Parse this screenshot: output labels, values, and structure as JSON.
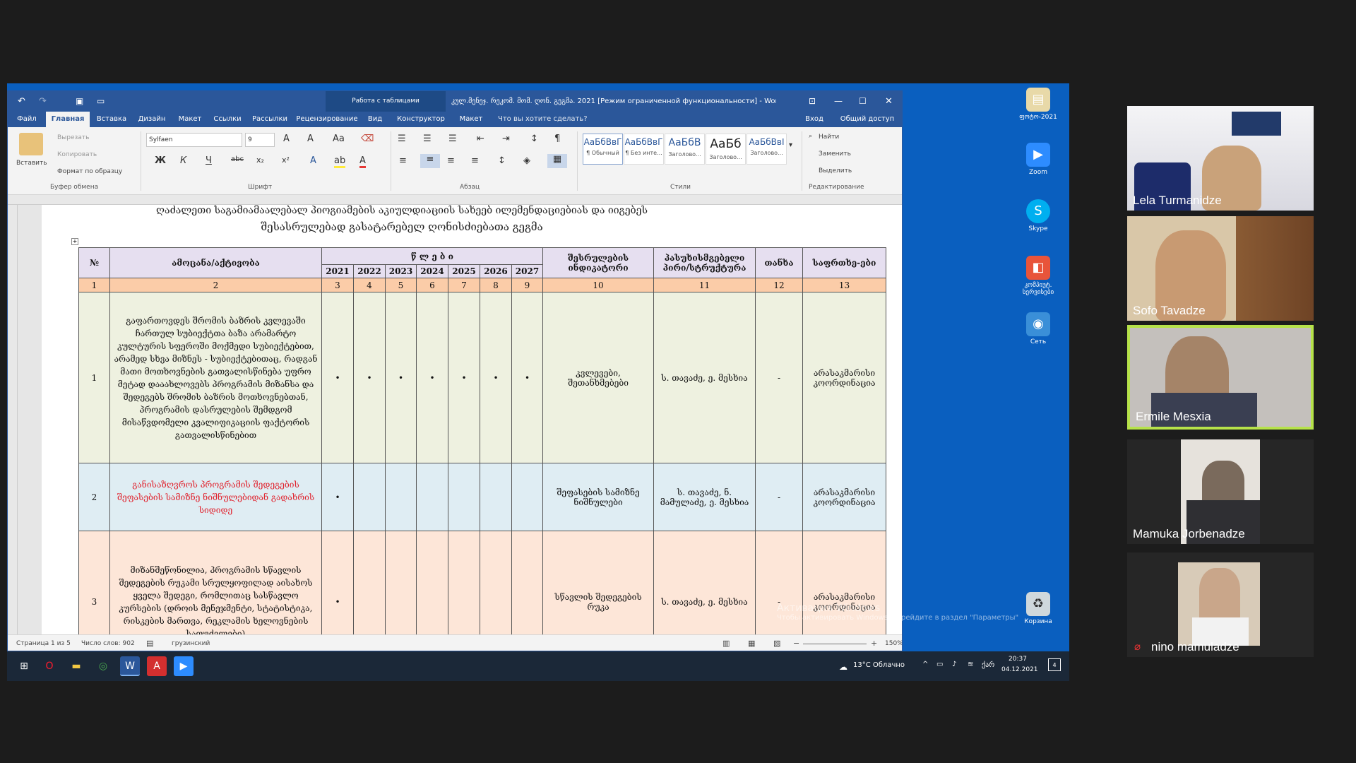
{
  "word": {
    "title": "კულ.მენეჯ. რეკომ. მომ. ღონ. გეგმა. 2021 [Режим ограниченной функциональности] - Word...",
    "contextual_group": "Работа с таблицами",
    "login": "Вход",
    "share": "Общий доступ",
    "tabs": [
      "Файл",
      "Главная",
      "Вставка",
      "Дизайн",
      "Макет",
      "Ссылки",
      "Рассылки",
      "Рецензирование",
      "Вид",
      "Конструктор",
      "Макет"
    ],
    "tell_me": "Что вы хотите сделать?",
    "ribbon": {
      "paste": "Вставить",
      "cut": "Вырезать",
      "copy": "Копировать",
      "format_painter": "Формат по образцу",
      "clipboard_group": "Буфер обмена",
      "font_name": "Sylfaen",
      "font_size": "9",
      "font_group": "Шрифт",
      "paragraph_group": "Абзац",
      "styles_group": "Стили",
      "editing_group": "Редактирование",
      "find": "Найти",
      "replace": "Заменить",
      "select": "Выделить",
      "styles": [
        {
          "sample": "АаБбВвГ",
          "name": "¶ Обычный"
        },
        {
          "sample": "АаБбВвГ",
          "name": "¶ Без инте..."
        },
        {
          "sample": "АаБбВ",
          "name": "Заголово..."
        },
        {
          "sample": "АаБб",
          "name": "Заголово..."
        },
        {
          "sample": "АаБбВвІ",
          "name": "Заголово..."
        }
      ]
    },
    "status": {
      "page": "Страница 1 из 5",
      "words": "Число слов: 902",
      "language": "грузинский",
      "zoom": "150%"
    }
  },
  "document": {
    "heading_line1": "ღაძალეთი საგამიამაალებალ პიოგიამების აკიულდიაციის სახეებ  ილემენდაციებიას და იიგებეს",
    "heading_line2": "შესასრულებად გასატარებელ ღონისძიებათა გეგმა",
    "columns": {
      "no": "№",
      "task": "ამოცანა/აქტივობა",
      "years_label": "წ ლ ე ბ ი",
      "years": [
        "2021",
        "2022",
        "2023",
        "2024",
        "2025",
        "2026",
        "2027"
      ],
      "indicator": "შესრულების ინდიკატორი",
      "responsible": "პასუხისმგებელი პირი/სტრუქტურა",
      "budget": "თანხა",
      "risks": "საფრთხე-ები"
    },
    "numbering": [
      "1",
      "2",
      "3",
      "4",
      "5",
      "6",
      "7",
      "8",
      "9",
      "10",
      "11",
      "12",
      "13"
    ],
    "rows": [
      {
        "no": "1",
        "task": "გაფართოვდეს შრომის ბაზრის კვლევაში ჩართულ სუბიექტთა ბაზა არამარტო კულტურის სფეროში მოქმედი სუბიექტებით, არამედ სხვა მიზნეს - სუბიექტებითაც, რადგან მათი მოთხოვნების გათვალისწინება უფრო მეტად დააახლოვებს პროგრამის მიზანსა და შედეგებს შრომის ბაზრის მოთხოვნებთან, პროგრამის დასრულების შემდგომ მისაწვდომელი კვალიფიკაციის ფაქტორის გათვალისწინებით",
        "marks": [
          "•",
          "•",
          "•",
          "•",
          "•",
          "•",
          "•"
        ],
        "indicator": "კვლევები, შეთანხმებები",
        "responsible": "ს. თავაძე, ე. მესხია",
        "budget": "-",
        "risks": "არასაკმარისი კოორდინაცია"
      },
      {
        "no": "2",
        "task": "განისაზღვროს პროგრამის შედეგების შეფასების სამიზნე ნიშნულებიდან გადახრის სიდიდე",
        "marks": [
          "•",
          "",
          "",
          "",
          "",
          "",
          ""
        ],
        "indicator": "შეფასების სამიზნე ნიშნულები",
        "responsible": "ს. თავაძე, ნ. მამულაძე, ე. მესხია",
        "budget": "-",
        "risks": "არასაკმარისი კოორდინაცია"
      },
      {
        "no": "3",
        "task": "მიზანშეწონილია, პროგრამის სწავლის შედეგების რუკამი სრულყოფილად აისახოს ყველა შედეგი, რომლითაც სასწავლო კურსების (დროის მენეჯმენტი, სტატისტიკა, რისკების მართვა, რეკლამის ხელოვნების საფუძვლები)",
        "marks": [
          "•",
          "",
          "",
          "",
          "",
          "",
          ""
        ],
        "indicator": "სწავლის შედეგების რუკა",
        "responsible": "ს. თავაძე, ე. მესხია",
        "budget": "-",
        "risks": "არასაკმარისი კოორდინაცია"
      }
    ]
  },
  "desktop": {
    "icons": [
      "ფოტო-2021",
      "Zoom",
      "Skype",
      "კომპიუტ. სერვისები",
      "Сеть",
      "Корзина"
    ],
    "watermark_title": "Активация Windows",
    "watermark_text": "Чтобы активировать Windows, перейдите в раздел \"Параметры\""
  },
  "taskbar": {
    "weather": "13°C  Облачно",
    "lang": "ქარ",
    "time": "20:37",
    "date": "04.12.2021",
    "notifications": "4"
  },
  "participants": [
    {
      "name": "Lela Turmanidze",
      "active": false,
      "muted": false
    },
    {
      "name": "Sofo Tavadze",
      "active": false,
      "muted": false
    },
    {
      "name": "Ermile Mesxia",
      "active": true,
      "muted": false
    },
    {
      "name": "Mamuka Jorbenadze",
      "active": false,
      "muted": false
    },
    {
      "name": "nino mamuladze",
      "active": false,
      "muted": true
    }
  ]
}
